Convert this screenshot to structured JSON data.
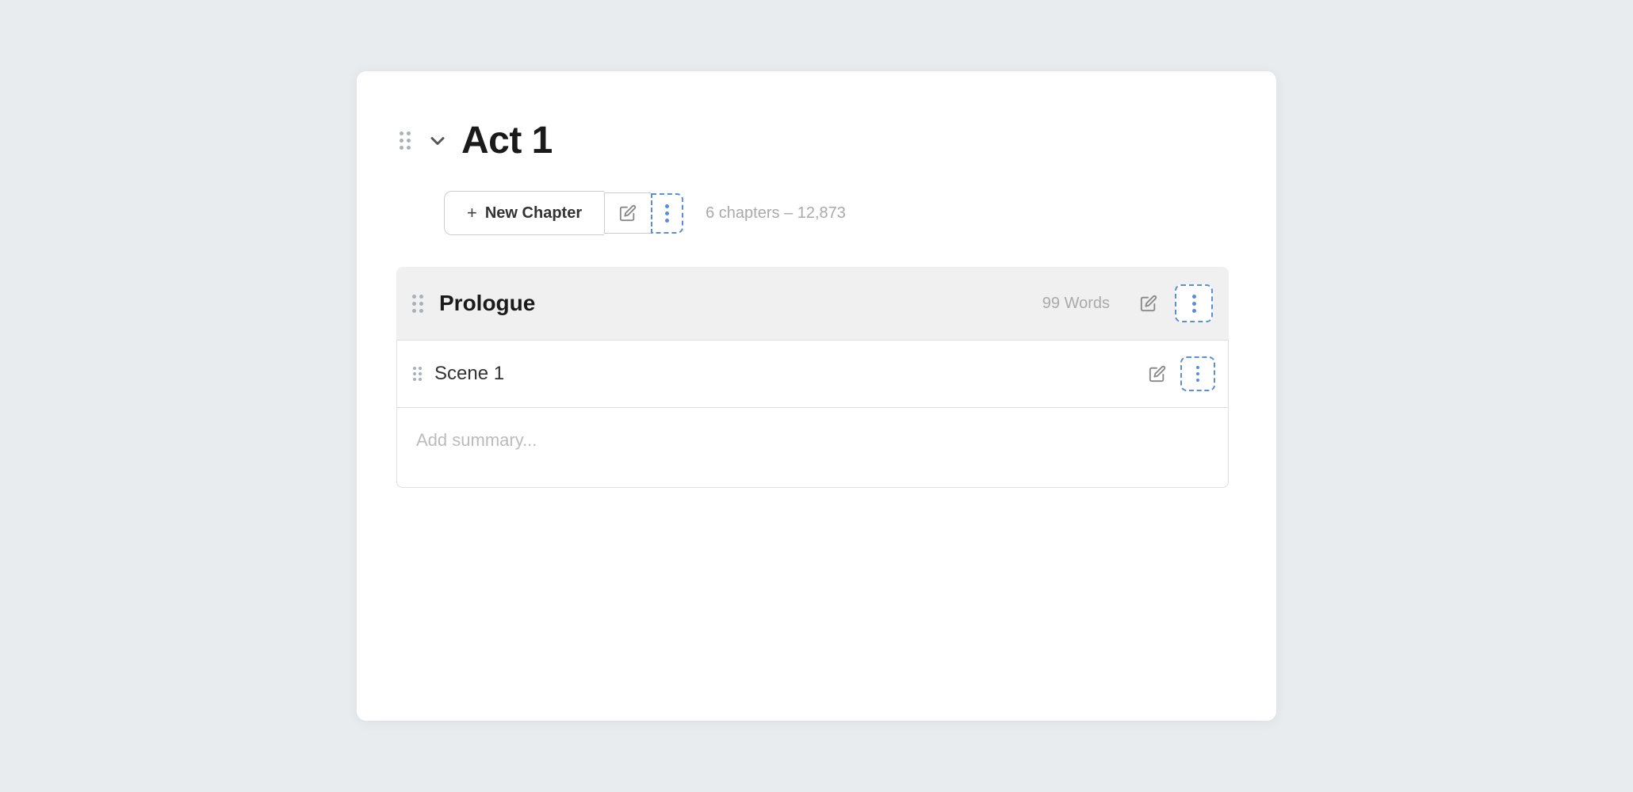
{
  "act": {
    "title": "Act 1",
    "drag_handle_label": "drag-handle",
    "chevron": "chevron-down",
    "action_bar": {
      "new_chapter_label": "+ New Chapter",
      "plus_symbol": "+",
      "new_chapter_text": "New Chapter",
      "edit_icon": "pencil",
      "more_icon": "three-dots-vertical",
      "chapter_count_text": "6 chapters",
      "dash": "–",
      "word_count": "12,873"
    }
  },
  "chapter": {
    "title": "Prologue",
    "word_count_label": "99 Words",
    "edit_icon": "pencil",
    "more_icon": "three-dots-vertical"
  },
  "scene": {
    "title": "Scene 1",
    "edit_icon": "pencil",
    "more_icon": "three-dots-vertical",
    "summary_placeholder": "Add summary..."
  }
}
